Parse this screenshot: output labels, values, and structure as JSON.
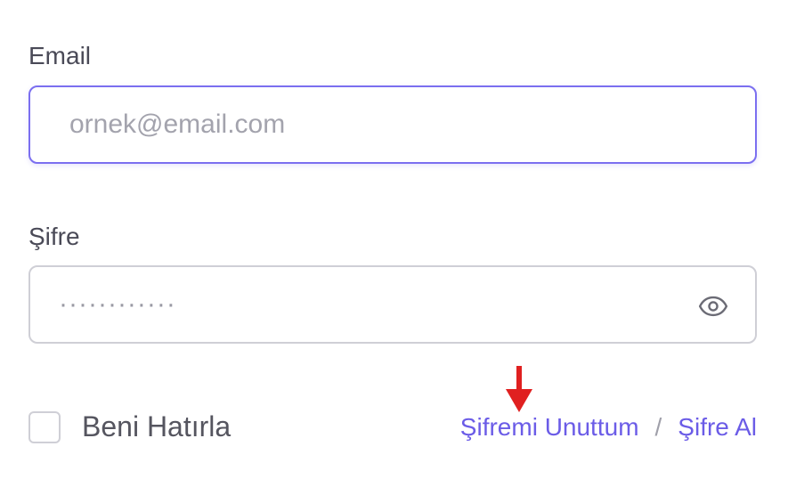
{
  "form": {
    "email": {
      "label": "Email",
      "value": "",
      "placeholder": "ornek@email.com"
    },
    "password": {
      "label": "Şifre",
      "value": "",
      "placeholder": "············",
      "toggle_icon": "eye-icon"
    },
    "remember": {
      "label": "Beni Hatırla",
      "checked": false
    },
    "links": {
      "forgot": "Şifremi Unuttum",
      "separator": "/",
      "get_password": "Şifre Al"
    }
  },
  "annotation": {
    "icon": "arrow-down-icon",
    "color": "#e02020"
  },
  "colors": {
    "accent": "#6b5ce7",
    "focus_border": "#7b6ff0",
    "border": "#cfcfd6",
    "label": "#4a4a57"
  }
}
